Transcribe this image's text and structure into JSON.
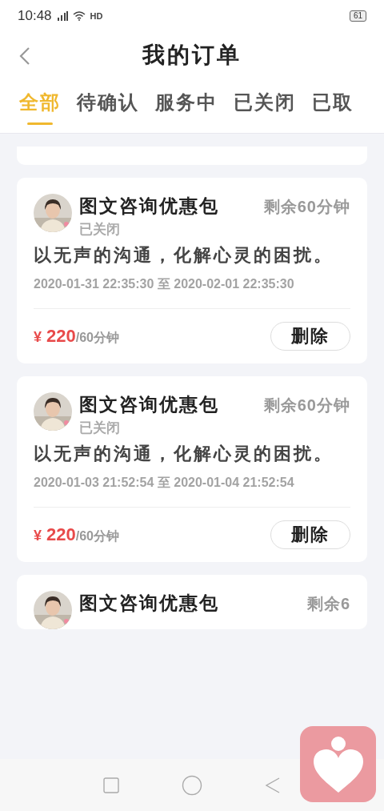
{
  "status_bar": {
    "time": "10:48",
    "network_label": "HD",
    "battery": "61"
  },
  "header": {
    "title": "我的订单"
  },
  "tabs": [
    {
      "label": "全部",
      "selected": true
    },
    {
      "label": "待确认",
      "selected": false
    },
    {
      "label": "服务中",
      "selected": false
    },
    {
      "label": "已关闭",
      "selected": false
    },
    {
      "label": "已取",
      "selected": false
    }
  ],
  "orders": [
    {
      "title": "图文咨询优惠包",
      "remaining": "剩余60分钟",
      "status": "已关闭",
      "description": "以无声的沟通，化解心灵的困扰。",
      "period": "2020-01-31 22:35:30 至 2020-02-01 22:35:30",
      "currency": "¥",
      "price": "220",
      "unit": "/60分钟",
      "action": "删除"
    },
    {
      "title": "图文咨询优惠包",
      "remaining": "剩余60分钟",
      "status": "已关闭",
      "description": "以无声的沟通，化解心灵的困扰。",
      "period": "2020-01-03 21:52:54 至 2020-01-04 21:52:54",
      "currency": "¥",
      "price": "220",
      "unit": "/60分钟",
      "action": "删除"
    },
    {
      "title": "图文咨询优惠包",
      "remaining": "剩余6"
    }
  ]
}
